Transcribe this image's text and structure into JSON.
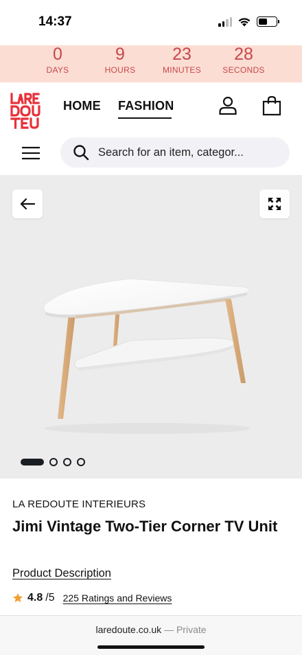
{
  "status_bar": {
    "time": "14:37",
    "battery_level": 0.5
  },
  "countdown": [
    {
      "value": "0",
      "label": "DAYS"
    },
    {
      "value": "9",
      "label": "HOURS"
    },
    {
      "value": "23",
      "label": "MINUTES"
    },
    {
      "value": "28",
      "label": "SECONDS"
    }
  ],
  "header": {
    "logo_text": "LA REDOUTE",
    "nav": [
      {
        "label": "HOME",
        "active": false
      },
      {
        "label": "FASHION",
        "active": true
      }
    ],
    "search_placeholder": "Search for an item, categor..."
  },
  "gallery": {
    "image_count": 4,
    "current_index": 1
  },
  "product": {
    "brand": "LA REDOUTE INTERIEURS",
    "title": "Jimi Vintage Two-Tier Corner TV Unit",
    "description_link": "Product Description",
    "rating": "4.8",
    "rating_max": "/5",
    "reviews_link": "225 Ratings and Reviews"
  },
  "browser": {
    "domain": "laredoute.co.uk",
    "mode": "— Private"
  },
  "colors": {
    "accent": "#e8303a",
    "countdown_bg": "#fbddd3",
    "countdown_text": "#c8474b",
    "star": "#f0a030"
  }
}
